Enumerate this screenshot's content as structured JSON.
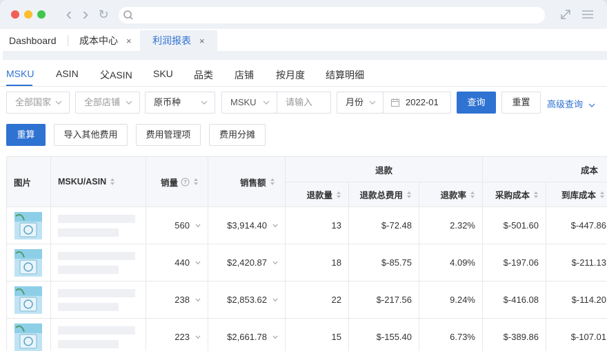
{
  "browser": {
    "back_glyph": "‹",
    "forward_glyph": "›",
    "reload_glyph": "↻"
  },
  "tabs": [
    {
      "label": "Dashboard"
    },
    {
      "label": "成本中心",
      "close": "×"
    },
    {
      "label": "利润报表",
      "close": "×",
      "active": true
    }
  ],
  "subtabs": [
    "MSKU",
    "ASIN",
    "父ASIN",
    "SKU",
    "品类",
    "店铺",
    "按月度",
    "结算明细"
  ],
  "filters": {
    "country": "全部国家",
    "store": "全部店铺",
    "currency": "原币种",
    "field_type": "MSKU",
    "keyword_placeholder": "请输入",
    "period_type": "月份",
    "date": "2022-01",
    "query_label": "查询",
    "reset_label": "重置",
    "advanced_label": "高级查询"
  },
  "actions": {
    "recalc": "重算",
    "import_fees": "导入其他费用",
    "fee_items": "费用管理项",
    "fee_allocation": "费用分摊"
  },
  "table": {
    "headers": {
      "image": "图片",
      "msku_asin": "MSKU/ASIN",
      "sales_qty": "销量",
      "sales_amount": "销售额",
      "refund_group": "退款",
      "refund_qty": "退款量",
      "refund_fee": "退款总费用",
      "refund_rate": "退款率",
      "cost_group": "成本",
      "purchase_cost": "采购成本",
      "inbound_cost": "到库成本"
    },
    "rows": [
      {
        "sales_qty": "560",
        "sales_amount": "$3,914.40",
        "refund_qty": "13",
        "refund_fee": "$-72.48",
        "refund_rate": "2.32%",
        "purchase_cost": "$-501.60",
        "inbound_cost": "$-447.86"
      },
      {
        "sales_qty": "440",
        "sales_amount": "$2,420.87",
        "refund_qty": "18",
        "refund_fee": "$-85.75",
        "refund_rate": "4.09%",
        "purchase_cost": "$-197.06",
        "inbound_cost": "$-211.13"
      },
      {
        "sales_qty": "238",
        "sales_amount": "$2,853.62",
        "refund_qty": "22",
        "refund_fee": "$-217.56",
        "refund_rate": "9.24%",
        "purchase_cost": "$-416.08",
        "inbound_cost": "$-114.20"
      },
      {
        "sales_qty": "223",
        "sales_amount": "$2,661.78",
        "refund_qty": "15",
        "refund_fee": "$-155.40",
        "refund_rate": "6.73%",
        "purchase_cost": "$-389.86",
        "inbound_cost": "$-107.01"
      }
    ]
  },
  "colors": {
    "accent": "#2e72d2",
    "titlebar": "#eef1f6",
    "header_bg": "#f5f7fa"
  }
}
